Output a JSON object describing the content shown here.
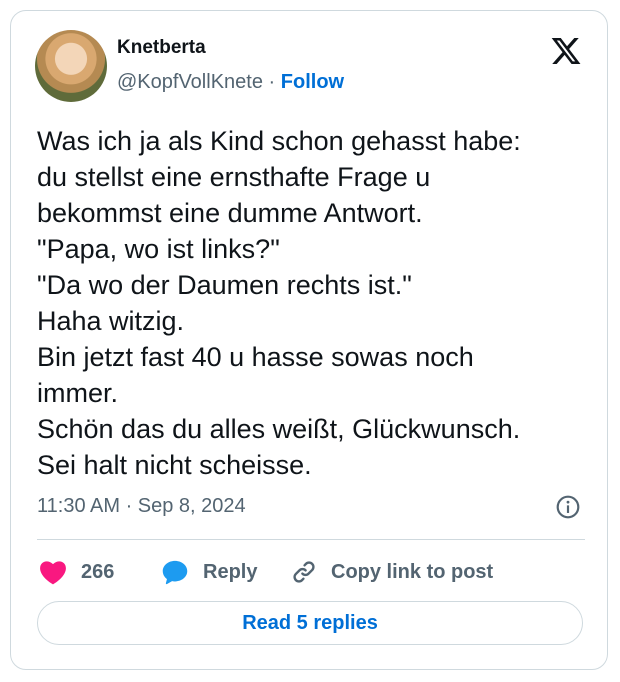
{
  "author": {
    "name": "Knetberta",
    "handle": "@KopfVollKnete",
    "separator": "·",
    "follow_label": "Follow"
  },
  "tweet": {
    "lines": [
      "Was ich ja als Kind schon gehasst habe:",
      "du stellst eine ernsthafte Frage u",
      "bekommst eine dumme Antwort.",
      "\"Papa, wo ist links?\"",
      "\"Da wo der Daumen rechts ist.\"",
      "Haha witzig.",
      "Bin jetzt fast 40 u hasse sowas noch",
      "immer.",
      "Schön das du alles weißt, Glückwunsch.",
      "Sei halt nicht scheisse."
    ],
    "timestamp": "11:30 AM · Sep 8, 2024"
  },
  "actions": {
    "like_count": "266",
    "reply_label": "Reply",
    "copy_label": "Copy link to post"
  },
  "read_replies_label": "Read 5 replies",
  "colors": {
    "like": "#f91880",
    "reply": "#1d9bf0",
    "link": "#006fd6",
    "muted": "#536471",
    "border": "#cfd9de"
  },
  "icons": {
    "brand": "x-logo-icon",
    "info": "info-icon",
    "like": "heart-icon",
    "reply": "speech-bubble-icon",
    "copy": "link-icon"
  }
}
